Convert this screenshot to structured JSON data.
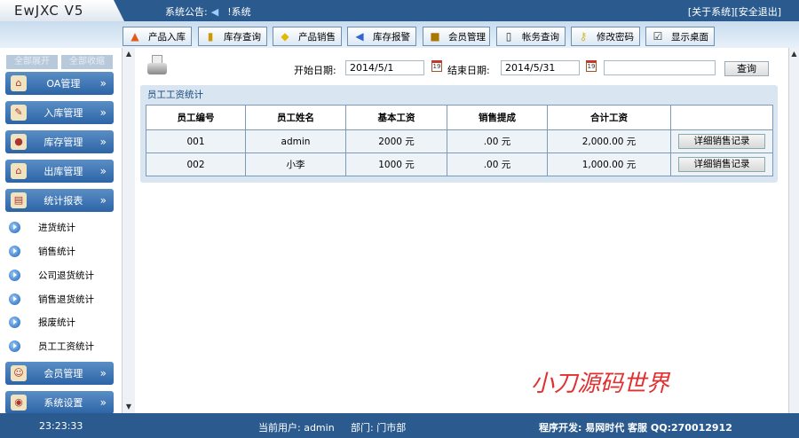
{
  "app": {
    "title": "EwJXC V5"
  },
  "header": {
    "notice_label": "系统公告:",
    "notice_text": "!系统",
    "about": "[关于系统]",
    "logout": "[安全退出]"
  },
  "toolbar": [
    {
      "label": "产品入库",
      "icon": "house-icon"
    },
    {
      "label": "库存查询",
      "icon": "book-icon"
    },
    {
      "label": "产品销售",
      "icon": "tag-icon"
    },
    {
      "label": "库存报警",
      "icon": "speaker-icon"
    },
    {
      "label": "会员管理",
      "icon": "member-icon"
    },
    {
      "label": "帐务查询",
      "icon": "account-icon"
    },
    {
      "label": "修改密码",
      "icon": "key-icon"
    },
    {
      "label": "显示桌面",
      "icon": "desktop-icon"
    }
  ],
  "sidebar": {
    "expand_all": "全部展开",
    "collapse_all": "全部收缩",
    "menus": [
      {
        "label": "OA管理"
      },
      {
        "label": "入库管理"
      },
      {
        "label": "库存管理"
      },
      {
        "label": "出库管理"
      },
      {
        "label": "统计报表"
      }
    ],
    "sub_items": [
      {
        "label": "进货统计"
      },
      {
        "label": "销售统计"
      },
      {
        "label": "公司退货统计"
      },
      {
        "label": "销售退货统计"
      },
      {
        "label": "报废统计"
      },
      {
        "label": "员工工资统计"
      }
    ],
    "bottom_menus": [
      {
        "label": "会员管理"
      },
      {
        "label": "系统设置"
      }
    ],
    "chevron": "»"
  },
  "filter": {
    "start_label": "开始日期:",
    "start_value": "2014/5/1",
    "end_label": "结束日期:",
    "end_value": "2014/5/31",
    "extra_value": "",
    "query_button": "查询",
    "cal_day": "19"
  },
  "panel": {
    "title": "员工工资统计",
    "columns": [
      "员工编号",
      "员工姓名",
      "基本工资",
      "销售提成",
      "合计工资",
      ""
    ],
    "rows": [
      {
        "id": "001",
        "name": "admin",
        "base": "2000 元",
        "commission": ".00 元",
        "total": "2,000.00 元",
        "action": "详细销售记录"
      },
      {
        "id": "002",
        "name": "小李",
        "base": "1000 元",
        "commission": ".00 元",
        "total": "1,000.00 元",
        "action": "详细销售记录"
      }
    ]
  },
  "watermark": "小刀源码世界",
  "footer": {
    "time": "23:23:33",
    "user": "当前用户: admin",
    "dept": "部门: 门市部",
    "dev": "程序开发: 易网时代 客服 QQ:270012912"
  }
}
